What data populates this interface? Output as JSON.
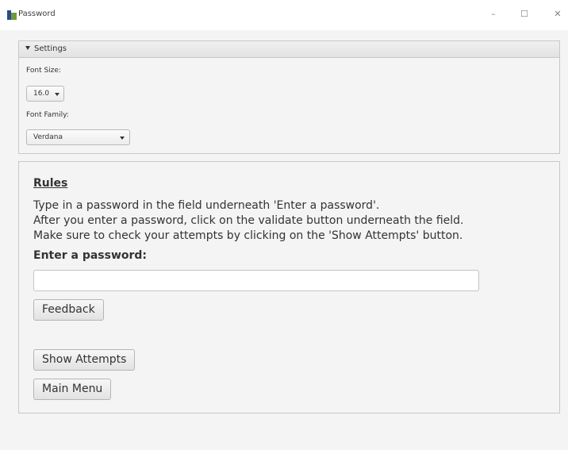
{
  "window": {
    "title": "Password",
    "minimize_glyph": "–",
    "maximize_glyph": "☐",
    "close_glyph": "✕"
  },
  "settings": {
    "header": "Settings",
    "font_size_label": "Font Size:",
    "font_size_value": "16.0",
    "font_family_label": "Font Family:",
    "font_family_value": "Verdana"
  },
  "main": {
    "rules_heading": "Rules",
    "rules_lines": [
      "Type in a password in the field underneath 'Enter a password'.",
      "After you enter a password, click on the validate button underneath the field.",
      "Make sure to check your attempts by clicking on the 'Show Attempts' button."
    ],
    "password_label": "Enter a password:",
    "password_value": "",
    "feedback_button": "Feedback",
    "show_attempts_button": "Show Attempts",
    "main_menu_button": "Main Menu"
  }
}
